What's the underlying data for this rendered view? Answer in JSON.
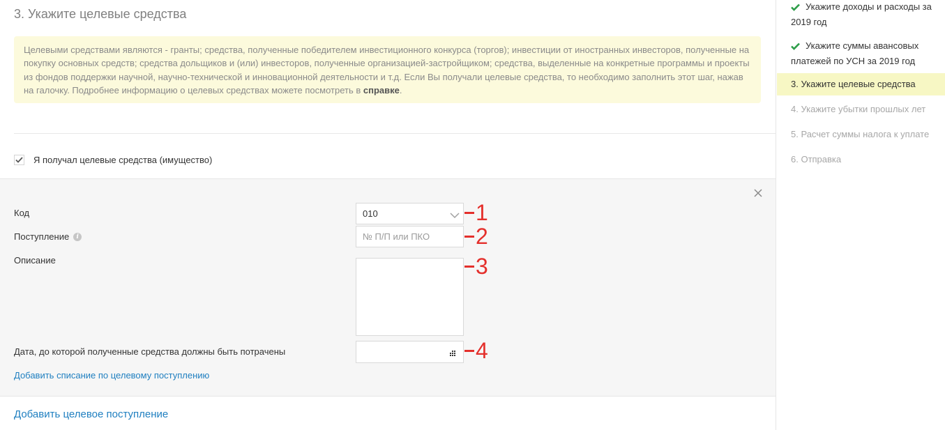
{
  "main": {
    "step_title": "3. Укажите целевые средства",
    "info": {
      "text": "Целевыми средствами являются - гранты; средства, полученные победителем инвестиционного конкурса (торгов); инвестиции от иностранных инвесторов, полученные на покупку основных средств; средства дольщиков и (или) инвесторов, полученные организацией-застройщиком; средства, выделенные на конкретные программы и проекты из фондов поддержки научной, научно-технической и инновационной деятельности и т.д. Если Вы получали целевые средства, то необходимо заполнить этот шаг, нажав на галочку. Подробнее информацию о целевых средствах можете посмотреть в ",
      "link": "справке",
      "end": "."
    },
    "checkbox": {
      "label": "Я получал целевые средства (имущество)",
      "checked": true
    },
    "form": {
      "code_label": "Код",
      "code_value": "010",
      "receipt_label": "Поступление",
      "receipt_placeholder": "№ П/П или ПКО",
      "description_label": "Описание",
      "description_value": "",
      "date_label": "Дата, до которой полученные средства должны быть потрачены",
      "date_value": "",
      "add_writeoff_link": "Добавить списание по целевому поступлению"
    },
    "annotations": [
      "1",
      "2",
      "3",
      "4"
    ],
    "add_receipt_link": "Добавить целевое поступление"
  },
  "sidebar": {
    "items": [
      {
        "label_line1": "Укажите доходы и расходы за",
        "label_line2": "2019 год",
        "status": "done"
      },
      {
        "label_line1": "Укажите суммы авансовых",
        "label_line2": "платежей по УСН за 2019 год",
        "status": "done"
      },
      {
        "label": "3.  Укажите целевые средства",
        "status": "active"
      },
      {
        "label": "4.  Укажите убытки прошлых лет",
        "status": "pending"
      },
      {
        "label": "5.  Расчет суммы налога к уплате",
        "status": "pending"
      },
      {
        "label": "6.  Отправка",
        "status": "pending"
      }
    ]
  },
  "colors": {
    "accent_link": "#1f7fc0",
    "check_green": "#2e9e4a",
    "annotation_red": "#e4302c",
    "info_bg": "#fcfadc",
    "active_step_bg": "#f7f7c4"
  }
}
